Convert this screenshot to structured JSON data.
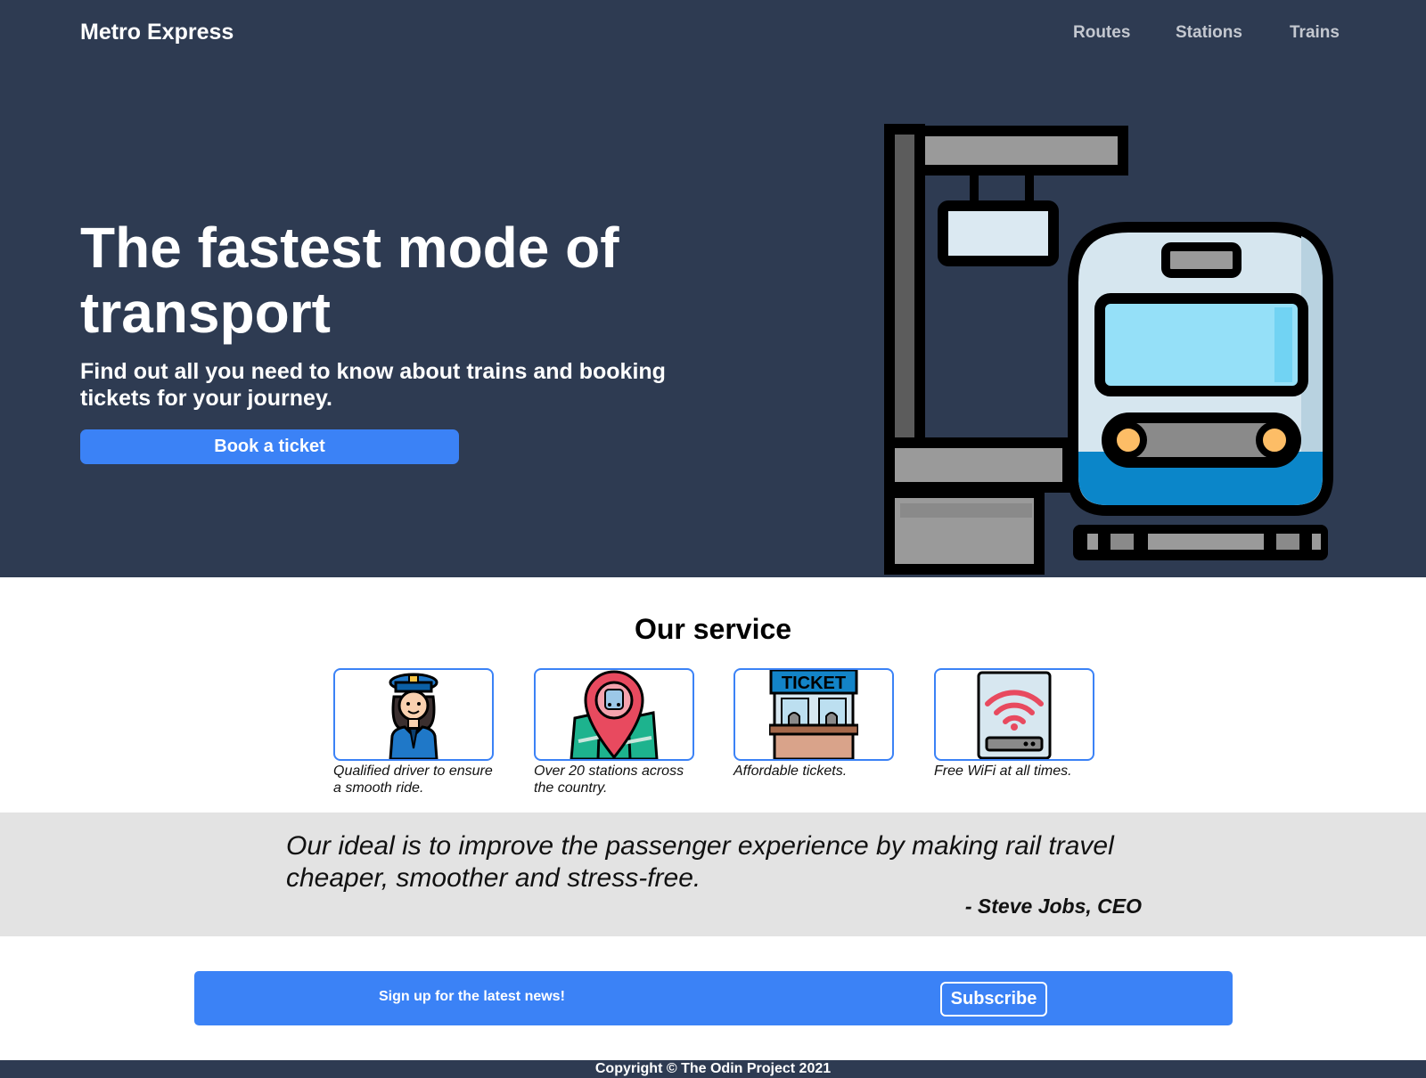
{
  "header": {
    "brand": "Metro Express",
    "nav": [
      {
        "label": "Routes"
      },
      {
        "label": "Stations"
      },
      {
        "label": "Trains"
      }
    ]
  },
  "hero": {
    "title": "The fastest mode of transport",
    "subtitle": "Find out all you need to know about trains and booking tickets for your journey.",
    "cta_label": "Book a ticket",
    "illustration_icon": "train-station-icon"
  },
  "services": {
    "title": "Our service",
    "items": [
      {
        "icon": "train-driver-icon",
        "text": "Qualified driver to ensure a smooth ride."
      },
      {
        "icon": "map-pin-icon",
        "text": "Over 20 stations across the country."
      },
      {
        "icon": "ticket-booth-icon",
        "text": "Affordable tickets."
      },
      {
        "icon": "wifi-router-icon",
        "text": "Free WiFi at all times."
      }
    ]
  },
  "quote": {
    "text": "Our ideal is to improve the passenger experience by making rail travel cheaper, smoother and stress-free.",
    "author": "- Steve Jobs, CEO"
  },
  "signup": {
    "text": "Sign up for the latest news!",
    "button_label": "Subscribe"
  },
  "footer": {
    "copyright": "Copyright © The Odin Project 2021"
  },
  "colors": {
    "hero_bg": "#2e3b52",
    "accent": "#3b82f6",
    "quote_bg": "#e3e3e3",
    "nav_text": "#c4c8d0"
  }
}
